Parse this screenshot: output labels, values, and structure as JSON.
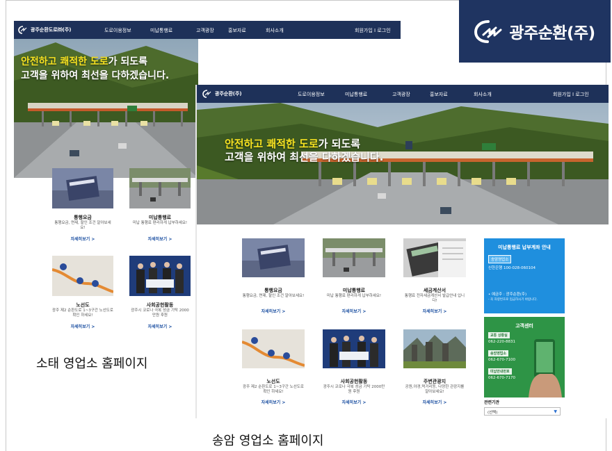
{
  "brand": {
    "name": "광주순환(주)"
  },
  "sotae": {
    "nav": {
      "logo": "광주순환도로㈜(주)",
      "menu": [
        "도로이용정보",
        "미납통행료",
        "고객광장",
        "홍보자료",
        "회사소개"
      ],
      "join": "회원가입",
      "sep": "I",
      "login": "로그인"
    },
    "hero": {
      "hl1": "안전하고 쾌적한 도로",
      "rest1": "가 되도록",
      "line2": "고객을 위하여 최선을 다하겠습니다."
    },
    "cards": [
      {
        "title": "통행요금",
        "desc": "통행요금, 면제, 할인 조건 알아보세요!",
        "more": "자세히보기 >"
      },
      {
        "title": "미납통행료",
        "desc": "미납 통행료 편리하게 납부하세요!",
        "more": "자세히보기 >"
      },
      {
        "title": "노선도",
        "desc": "광주 제2 순환도로 1~3구간 노선도로 확인 하세요!",
        "more": "자세히보기 >"
      },
      {
        "title": "사회공헌활동",
        "desc": "광주시 코로나 극복 성금 기탁 2000만원 후원",
        "more": "자세히보기 >"
      }
    ],
    "caption": "소태 영업소 홈페이지"
  },
  "songam": {
    "nav": {
      "logo": "광주순환(주)",
      "menu": [
        "도로이용정보",
        "미납통행료",
        "고객광장",
        "홍보자료",
        "회사소개"
      ],
      "join": "회원가입",
      "sep": "I",
      "login": "로그인"
    },
    "hero": {
      "hl1": "안전하고 쾌적한 도로",
      "rest1": "가 되도록",
      "line2": "고객을 위하여 최선을 다하겠습니다."
    },
    "cards": [
      {
        "title": "통행요금",
        "desc": "통행요금, 면제, 할인 조건 알아보세요!",
        "more": "자세히보기 >"
      },
      {
        "title": "미납통행료",
        "desc": "미납 통행료 편리하게 납부하세요!",
        "more": "자세히보기 >"
      },
      {
        "title": "세금계산서",
        "desc": "통행료 전자세금계산서 발급안내 입니다!",
        "more": "자세히보기 >"
      },
      {
        "title": "노선도",
        "desc": "광주 제2 순환도로 1~3구간 노선도로 확인 하세요!",
        "more": "자세히보기 >"
      },
      {
        "title": "사회공헌활동",
        "desc": "광주시 코로나 극복 성금 기탁 2000만원 후원",
        "more": "자세히보기 >"
      },
      {
        "title": "주변관광지",
        "desc": "공원,야경,먹거리등, 다양한 관광지를 알아보세요!",
        "more": "자세히보기 >"
      }
    ],
    "notice": {
      "title": "미납통행료 납부계좌 안내",
      "badge": "송암영업소",
      "account": "신한은행 100-028-060104",
      "holder": "• 예금주 : 광주순환(주)",
      "note": "- 꼭 차량번호로 입금하시기 바랍니다."
    },
    "center": {
      "title": "고객센터",
      "items": [
        {
          "label": "교통 상황실",
          "phone": "062-220-8831"
        },
        {
          "label": "송암영업소",
          "phone": "062-670-7100"
        },
        {
          "label": "미납안내번호",
          "phone": "062-670-7170"
        }
      ]
    },
    "related": {
      "label": "관련기관",
      "selected": "(선택)"
    },
    "caption": "송암 영업소 홈페이지"
  },
  "colors": {
    "nav": "#1e3159",
    "brand_bg": "#1f3461",
    "notice": "#1f8fde",
    "center": "#2e9446",
    "highlight": "#f7e321",
    "link": "#1b4fa1"
  }
}
